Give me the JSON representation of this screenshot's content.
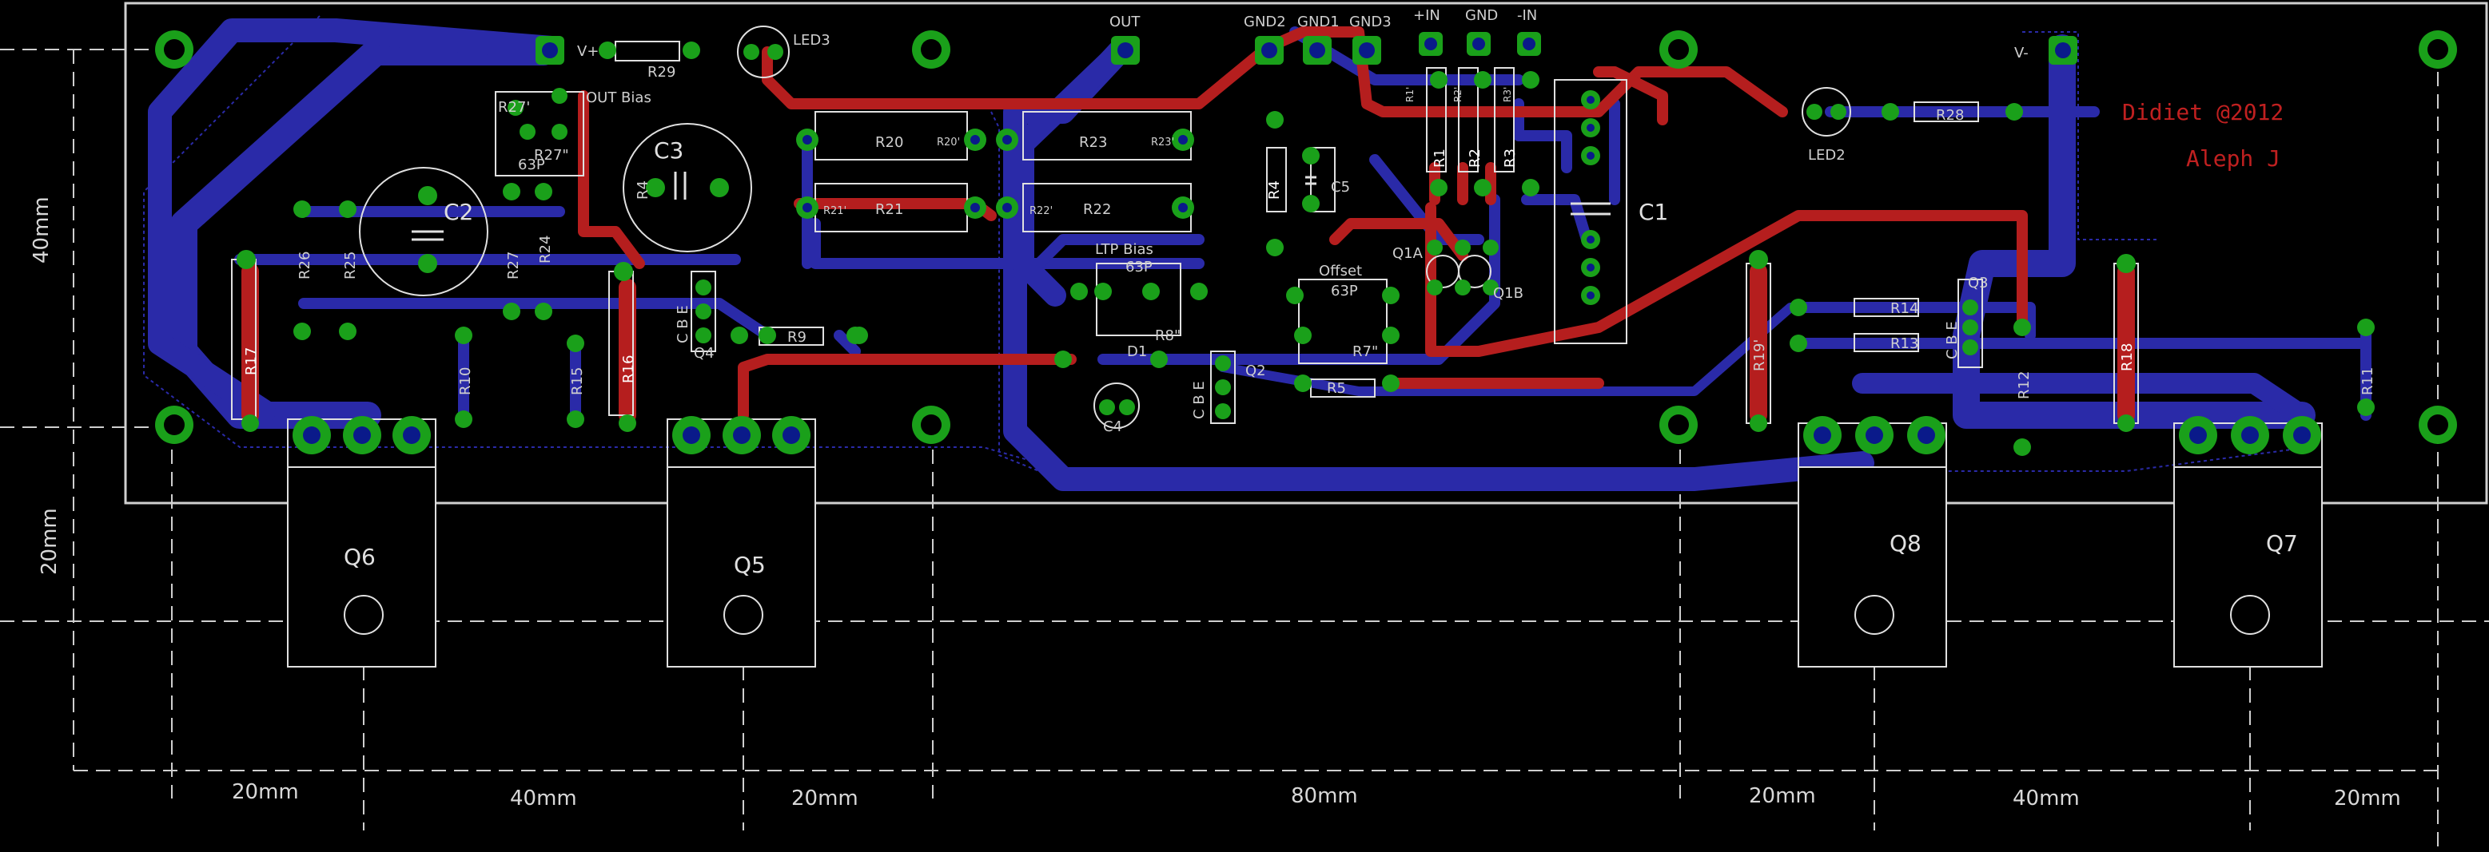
{
  "pcb": {
    "colors": {
      "background": "#000000",
      "bottom_trace": "#2a2aa8",
      "top_trace": "#b51e1e",
      "pad": "#1aa01a",
      "via": "#1aa01a",
      "hole": "#0a1a8a",
      "silk": "#e0e0e0",
      "dim": "#cfcfcf",
      "signature": "#c02020"
    },
    "signature": {
      "line1": "Didiet @2012",
      "line2": "Aleph J"
    },
    "connectors": {
      "out": "OUT",
      "gnd2": "GND2",
      "gnd1": "GND1",
      "gnd3": "GND3",
      "pin": "+IN",
      "gnd": "GND",
      "nin": "-IN",
      "vplus": "V+",
      "vminus": "V-"
    },
    "labels": {
      "r29": "R29",
      "led3": "LED3",
      "led2": "LED2",
      "r28": "R28",
      "out_bias": "OUT Bias",
      "r27p": "R27'",
      "r27pp": "R27\"",
      "p63": "63P",
      "c3": "C3",
      "c2": "C2",
      "c1": "C1",
      "c4": "C4",
      "c5": "C5",
      "r20": "R20",
      "r20s": "R20'",
      "r21": "R21",
      "r21s": "R21'",
      "r23": "R23",
      "r23s": "R23'",
      "r22": "R22",
      "r22s": "R22'",
      "r4": "R4",
      "r1": "R1",
      "r1s": "R1'",
      "r2": "R2",
      "r2s": "R2'",
      "r3": "R3",
      "r3s": "R3'",
      "ltp_bias": "LTP Bias",
      "offset": "Offset",
      "q1a": "Q1A",
      "q1b": "Q1B",
      "r8": "R8\"",
      "r7": "R7\"",
      "d1": "D1",
      "q2": "Q2",
      "q4": "Q4",
      "q3": "Q3",
      "r5": "R5",
      "r9": "R9",
      "r26": "R26",
      "r25": "R25",
      "r27": "R27",
      "r24": "R24",
      "r17": "R17",
      "r10": "R10",
      "r15": "R15",
      "r16": "R16",
      "r14": "R14",
      "r13": "R13",
      "r19": "R19'",
      "r12": "R12",
      "r18": "R18",
      "r11": "R11",
      "cbe": "C B E",
      "ecb": "E B C",
      "q6": "Q6",
      "q5": "Q5",
      "q8": "Q8",
      "q7": "Q7"
    },
    "dimensions": {
      "h40": "40mm",
      "h20": "20mm",
      "b1": "20mm",
      "b2": "40mm",
      "b3": "20mm",
      "b4": "80mm",
      "b5": "20mm",
      "b6": "40mm",
      "b7": "20mm"
    }
  }
}
